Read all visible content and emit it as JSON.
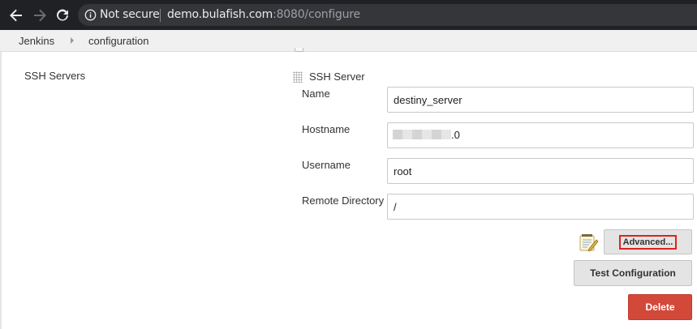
{
  "browser": {
    "security_label": "Not secure",
    "url_host": "demo.bulafish.com",
    "url_rest": ":8080/configure"
  },
  "breadcrumb": {
    "items": [
      "Jenkins",
      "configuration"
    ]
  },
  "section": {
    "label": "SSH Servers"
  },
  "ssh_server": {
    "title": "SSH Server",
    "fields": {
      "name": {
        "label": "Name",
        "value": "destiny_server"
      },
      "hostname": {
        "label": "Hostname",
        "visible_suffix": ".0"
      },
      "username": {
        "label": "Username",
        "value": "root"
      },
      "remote_directory": {
        "label": "Remote Directory",
        "value": "/"
      }
    },
    "buttons": {
      "advanced": "Advanced...",
      "test_configuration": "Test Configuration",
      "delete": "Delete"
    }
  },
  "colors": {
    "browser_chrome": "#202124",
    "url_box": "#35363a",
    "delete_button": "#d24939",
    "highlight_outline": "#e0221b"
  },
  "icons": [
    "back-arrow-icon",
    "forward-arrow-icon",
    "reload-icon",
    "info-icon",
    "drag-handle-icon",
    "notepad-icon"
  ]
}
